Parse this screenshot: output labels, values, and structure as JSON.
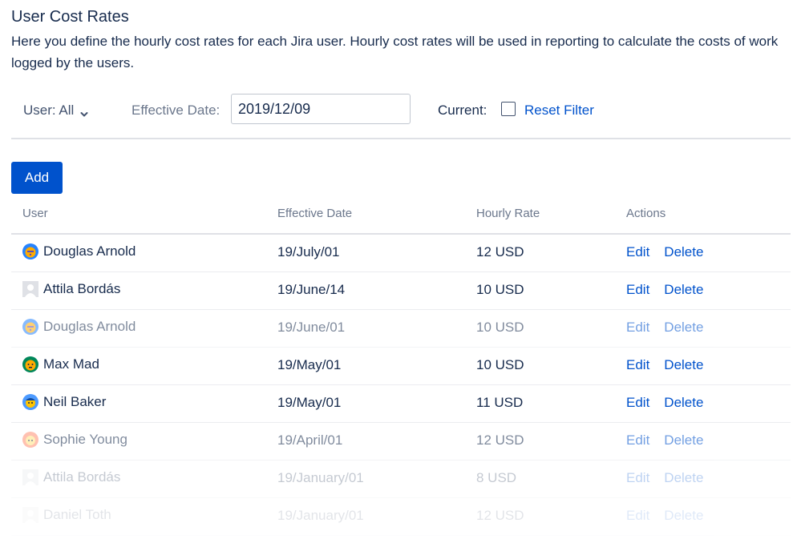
{
  "page": {
    "title": "User Cost Rates",
    "description": "Here you define the hourly cost rates for each Jira user. Hourly cost rates will be used in reporting to calculate the costs of work logged by the users."
  },
  "filters": {
    "user_label": "User: All",
    "effective_date_label": "Effective Date:",
    "effective_date_value": "2019/12/09",
    "current_label": "Current:",
    "current_checked": false,
    "reset_label": "Reset Filter"
  },
  "add_button": {
    "label": "Add"
  },
  "table": {
    "headers": {
      "user": "User",
      "effective_date": "Effective Date",
      "hourly_rate": "Hourly Rate",
      "actions": "Actions"
    },
    "rows": [
      {
        "user": "Douglas Arnold",
        "date": "19/July/01",
        "rate": "12 USD",
        "edit": "Edit",
        "delete": "Delete",
        "avatar": "orange-face-avatar-icon"
      },
      {
        "user": "Attila Bordás",
        "date": "19/June/14",
        "rate": "10 USD",
        "edit": "Edit",
        "delete": "Delete",
        "avatar": "default-user-avatar-icon"
      },
      {
        "user": "Douglas Arnold",
        "date": "19/June/01",
        "rate": "10 USD",
        "edit": "Edit",
        "delete": "Delete",
        "avatar": "orange-face-avatar-icon"
      },
      {
        "user": "Max Mad",
        "date": "19/May/01",
        "rate": "10 USD",
        "edit": "Edit",
        "delete": "Delete",
        "avatar": "teal-face-avatar-icon"
      },
      {
        "user": "Neil Baker",
        "date": "19/May/01",
        "rate": "11 USD",
        "edit": "Edit",
        "delete": "Delete",
        "avatar": "blue-face-avatar-icon"
      },
      {
        "user": "Sophie Young",
        "date": "19/April/01",
        "rate": "12 USD",
        "edit": "Edit",
        "delete": "Delete",
        "avatar": "peach-face-avatar-icon"
      },
      {
        "user": "Attila Bordás",
        "date": "19/January/01",
        "rate": "8 USD",
        "edit": "Edit",
        "delete": "Delete",
        "avatar": "default-user-avatar-icon"
      },
      {
        "user": "Daniel Toth",
        "date": "19/January/01",
        "rate": "12 USD",
        "edit": "Edit",
        "delete": "Delete",
        "avatar": "default-user-avatar-icon"
      }
    ]
  },
  "colors": {
    "accent": "#0052cc",
    "text": "#172b4d",
    "muted": "#6b778c",
    "divider": "#dfe1e6"
  }
}
